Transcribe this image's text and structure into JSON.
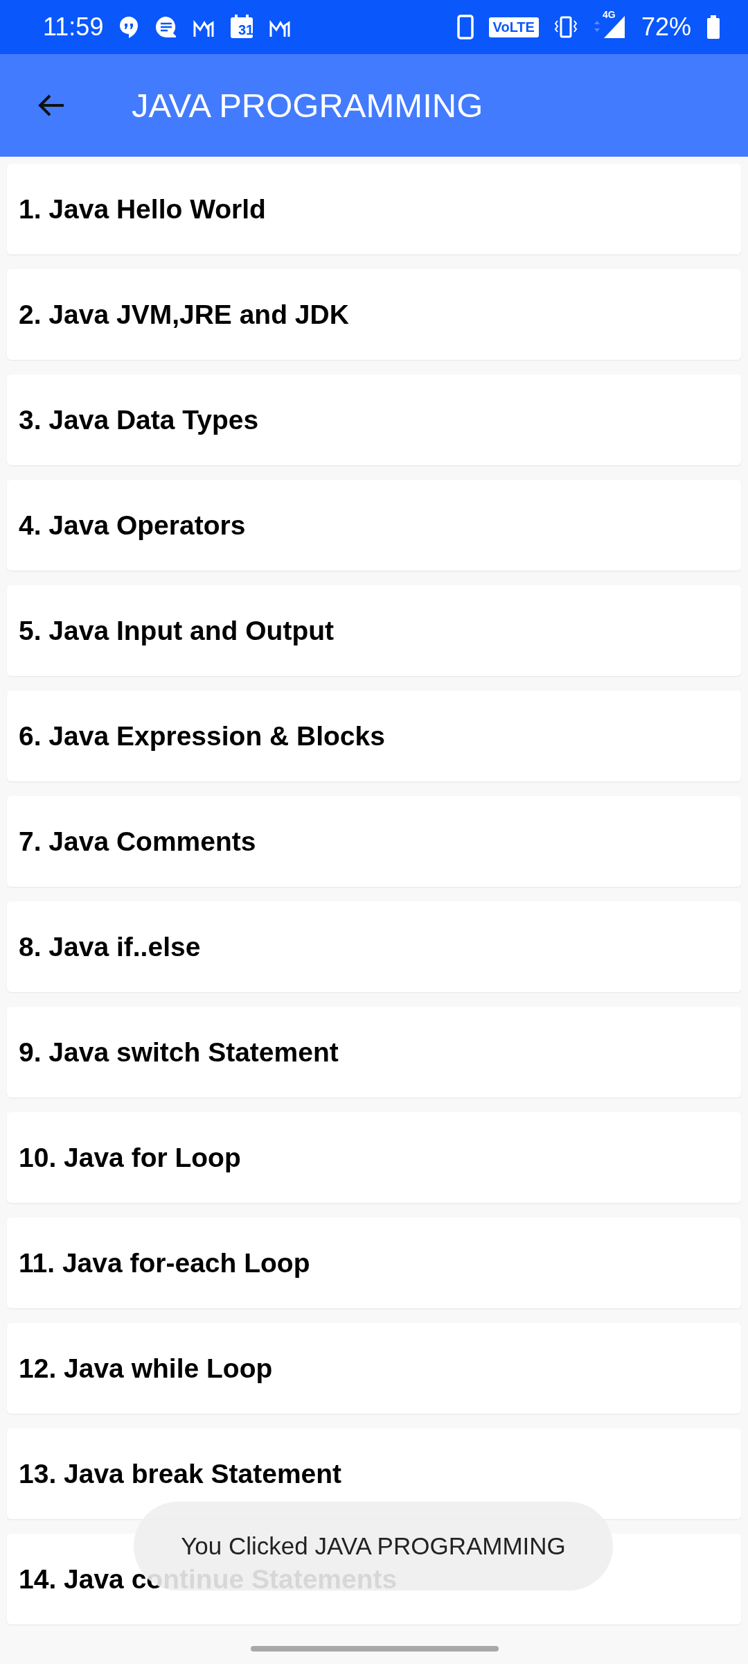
{
  "status_bar": {
    "time": "11:59",
    "calendar_day": "31",
    "volte": "VoLTE",
    "network": "4G",
    "battery": "72%"
  },
  "app_bar": {
    "title": "JAVA PROGRAMMING"
  },
  "items": [
    {
      "label": "1. Java Hello World"
    },
    {
      "label": "2. Java JVM,JRE and JDK"
    },
    {
      "label": "3. Java Data Types"
    },
    {
      "label": "4. Java Operators"
    },
    {
      "label": "5. Java Input and Output"
    },
    {
      "label": "6. Java Expression & Blocks"
    },
    {
      "label": "7. Java Comments"
    },
    {
      "label": "8. Java if..else"
    },
    {
      "label": "9. Java switch Statement"
    },
    {
      "label": "10. Java for Loop"
    },
    {
      "label": "11. Java for-each Loop"
    },
    {
      "label": "12. Java while Loop"
    },
    {
      "label": "13. Java break Statement"
    },
    {
      "label": "14. Java continue Statements"
    }
  ],
  "toast": {
    "text": "You Clicked JAVA PROGRAMMING"
  }
}
